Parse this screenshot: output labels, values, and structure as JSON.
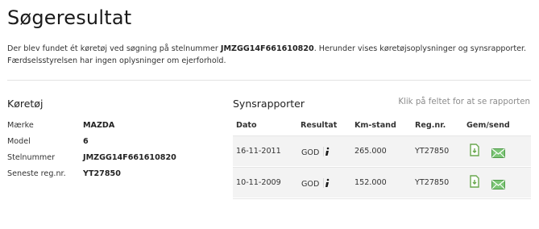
{
  "page": {
    "title": "Søgeresultat",
    "intro_before": "Der blev fundet ét køretøj ved søgning på stelnummer ",
    "intro_vin": "JMZGG14F661610820",
    "intro_after": ". Herunder vises køretøjsoplysninger og synsrapporter. Færdselsstyrelsen har ingen oplysninger om ejerforhold."
  },
  "vehicle": {
    "heading": "Køretøj",
    "fields": [
      {
        "label": "Mærke",
        "value": "MAZDA"
      },
      {
        "label": "Model",
        "value": "6"
      },
      {
        "label": "Stelnummer",
        "value": "JMZGG14F661610820"
      },
      {
        "label": "Seneste reg.nr.",
        "value": "YT27850"
      }
    ]
  },
  "reports": {
    "heading": "Synsrapporter",
    "hint": "Klik på feltet for at se rapporten",
    "columns": [
      "Dato",
      "Resultat",
      "Km-stand",
      "Reg.nr.",
      "Gem/send"
    ],
    "rows": [
      {
        "date": "16-11-2011",
        "result": "GOD",
        "km": "265.000",
        "reg": "YT27850"
      },
      {
        "date": "10-11-2009",
        "result": "GOD",
        "km": "152.000",
        "reg": "YT27850"
      }
    ],
    "icons": {
      "info": "info-icon",
      "save": "pdf-save-icon",
      "send": "email-icon"
    },
    "colors": {
      "save": "#6aa84f",
      "send": "#5cb85c"
    }
  }
}
